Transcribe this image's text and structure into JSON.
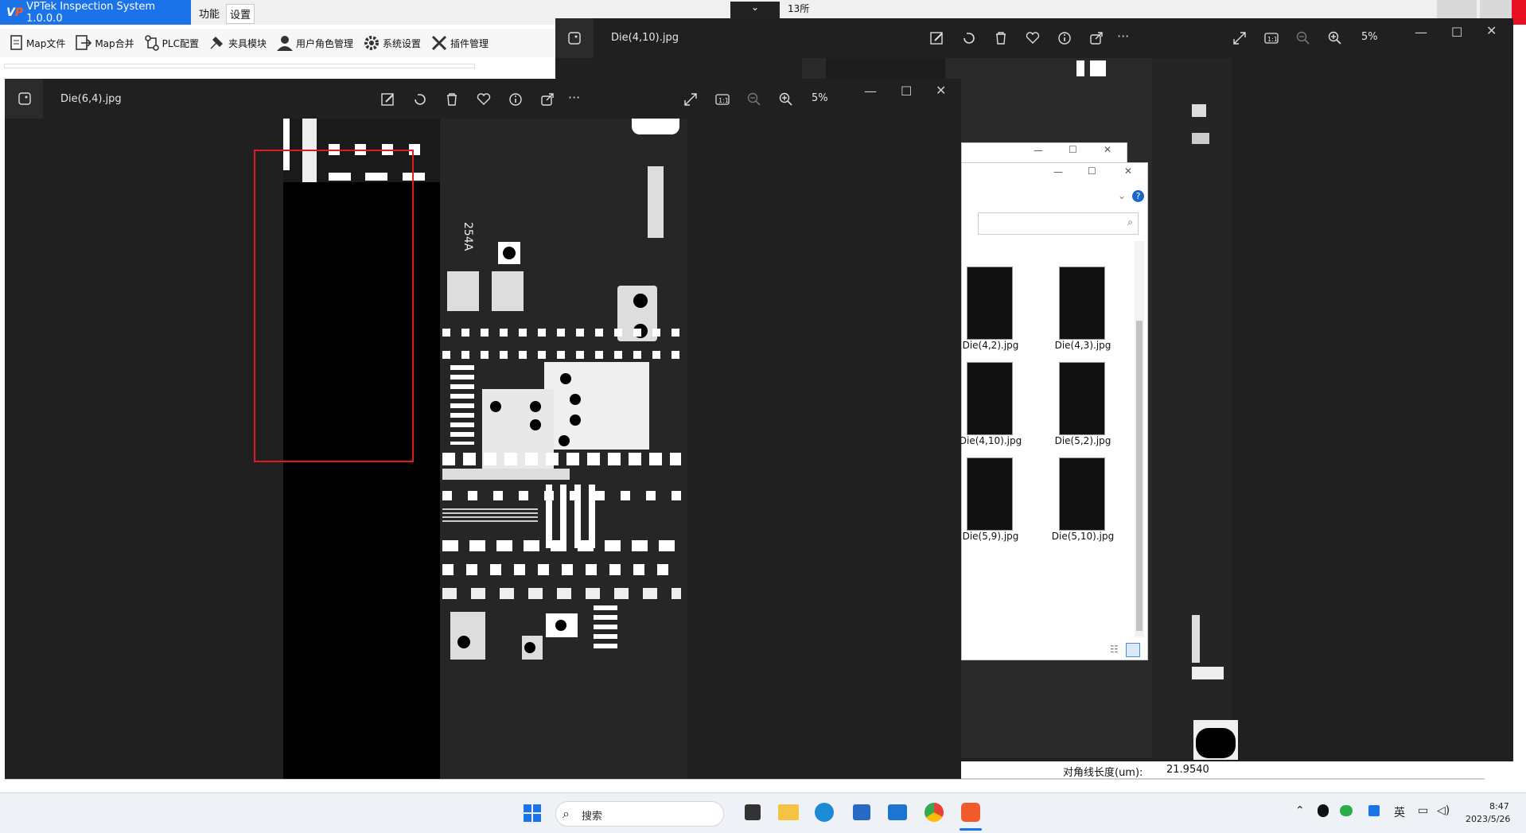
{
  "app": {
    "title": "VPTek Inspection System 1.0.0.0",
    "menus": [
      "功能",
      "设置"
    ],
    "toolbar": [
      "Map文件",
      "Map合并",
      "PLC配置",
      "夹具模块",
      "用户角色管理",
      "系统设置",
      "插件管理"
    ],
    "top_right_label": "13所",
    "status_label": "对角线长度(um):",
    "status_value": "21.9540"
  },
  "viewer_back": {
    "filename": "Die(4,10).jpg",
    "zoom": "5%"
  },
  "viewer_front": {
    "filename": "Die(6,4).jpg",
    "zoom": "5%",
    "chip_text": "254A"
  },
  "explorer": {
    "files": [
      "Die(4,2).jpg",
      "Die(4,3).jpg",
      "Die(4,10).jpg",
      "Die(5,2).jpg",
      "Die(5,9).jpg",
      "Die(5,10).jpg"
    ]
  },
  "taskbar": {
    "search_placeholder": "搜索",
    "ime": "英",
    "time": "8:47",
    "date": "2023/5/26"
  },
  "icons": [
    "image-icon",
    "edit-icon",
    "rotate-icon",
    "delete-icon",
    "heart-icon",
    "info-icon",
    "share-icon",
    "more-icon",
    "fullscreen-icon",
    "actual-size-icon",
    "zoom-out-icon",
    "zoom-in-icon"
  ],
  "colors": {
    "accent": "#1a73e8",
    "selection": "#e01b1b",
    "viewer_bg": "#202020"
  }
}
